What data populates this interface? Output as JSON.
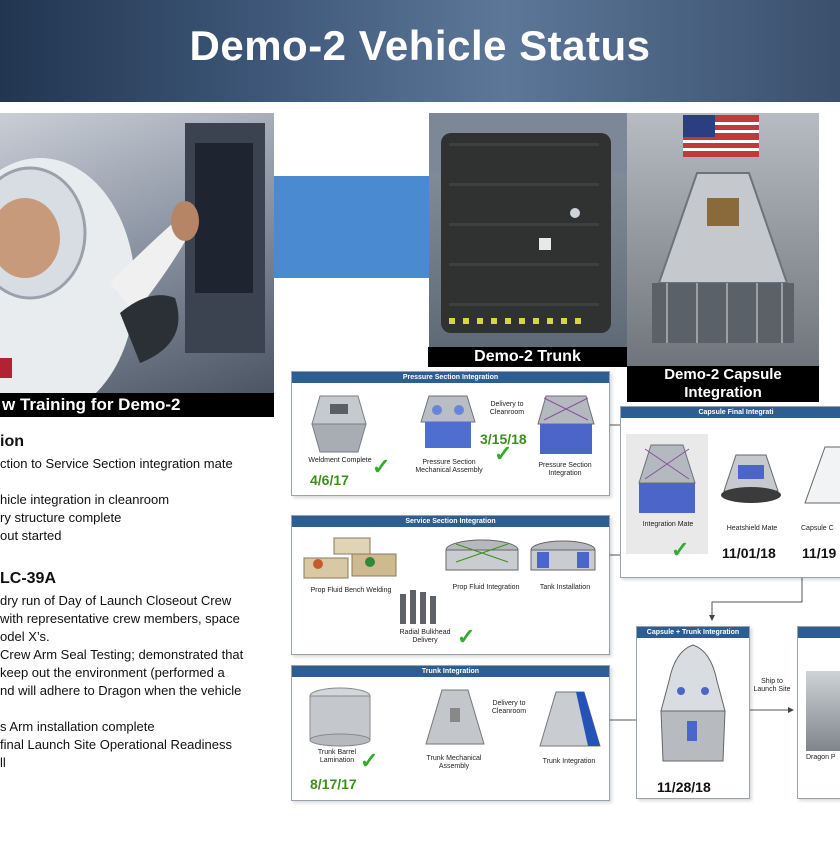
{
  "title": "Demo-2 Vehicle Status",
  "photos": {
    "crew_caption": "w Training for Demo-2",
    "trunk_caption": "Demo-2 Trunk",
    "capsule_caption_line1": "Demo-2 Capsule",
    "capsule_caption_line2": "Integration"
  },
  "left_text": {
    "heading1": "ion",
    "items1": [
      "ction to Service Section integration mate",
      "",
      "hicle integration in cleanroom",
      "ry structure complete",
      "out started"
    ],
    "heading2": "LC-39A",
    "items2": [
      "dry run of Day of Launch Closeout Crew",
      "with representative crew members, space",
      "odel X’s.",
      "Crew Arm Seal Testing; demonstrated that",
      " keep out the environment (performed a",
      "nd will adhere to Dragon when the vehicle",
      "",
      "s Arm installation complete",
      "final Launch Site Operational Readiness",
      "ll"
    ]
  },
  "flow": {
    "pressure": {
      "title": "Pressure Section Integration",
      "step1": "Weldment Complete",
      "step1_date": "4/6/17",
      "delivery": "Delivery to Cleanroom",
      "step2": "Pressure Section Mechanical Assembly",
      "step2_date": "3/15/18",
      "step3": "Pressure Section Integration"
    },
    "service": {
      "title": "Service Section Integration",
      "step1": "Prop Fluid Bench Welding",
      "step2": "Prop Fluid Integration",
      "step3": "Tank Installation",
      "step4": "Radial Bulkhead Delivery"
    },
    "trunk": {
      "title": "Trunk Integration",
      "step1": "Trunk Barrel Lamination",
      "step1_date": "8/17/17",
      "step2": "Trunk Mechanical Assembly",
      "delivery": "Delivery to Cleanroom",
      "step3": "Trunk Integration"
    },
    "capsule_final": {
      "title": "Capsule Final Integrati",
      "step1": "Integration Mate",
      "step2": "Heatshield Mate",
      "step2_date": "11/01/18",
      "step3": "Capsule C",
      "step3_date": "11/19"
    },
    "capsule_trunk": {
      "title": "Capsule + Trunk Integration",
      "date": "11/28/18",
      "ship": "Ship to Launch Site"
    },
    "launch": {
      "label": "Dragon P"
    }
  },
  "check_mark": "✓",
  "colors": {
    "panel_header": "#2e5d91",
    "date_green": "#3e8e1e",
    "check_green": "#2fae2a",
    "blue_block": "#4a8ad1"
  }
}
